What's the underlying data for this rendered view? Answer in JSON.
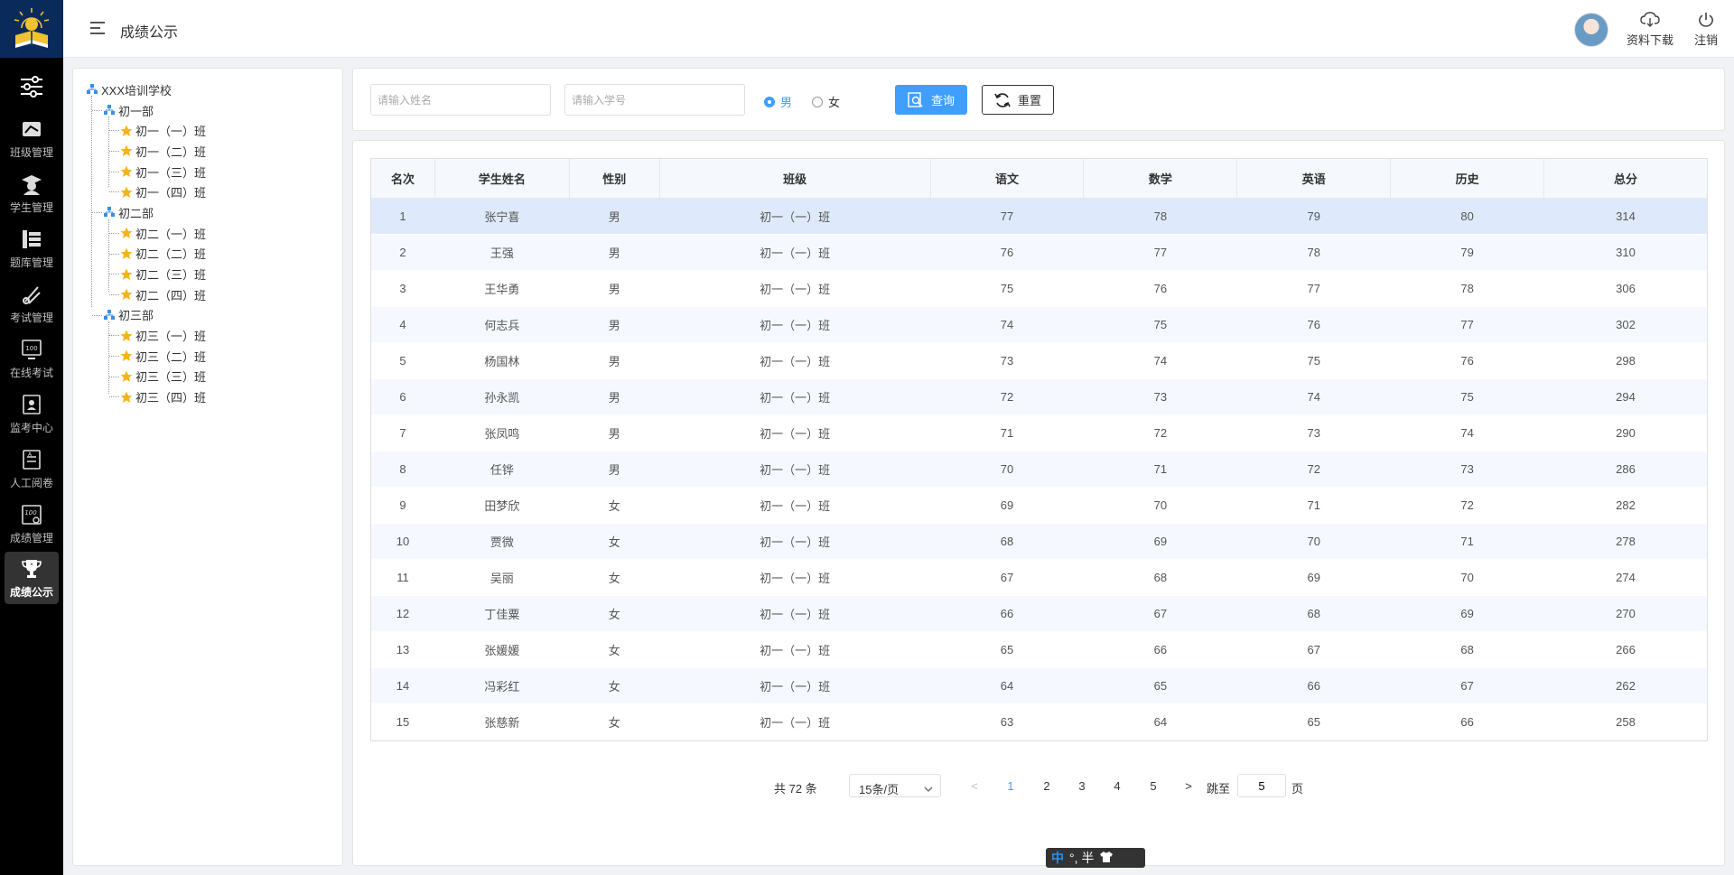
{
  "header": {
    "page_title": "成绩公示",
    "download_label": "资料下载",
    "logout_label": "注销"
  },
  "sidebar": {
    "items": [
      {
        "label": "班级管理",
        "icon": "class-icon"
      },
      {
        "label": "学生管理",
        "icon": "student-icon"
      },
      {
        "label": "题库管理",
        "icon": "question-bank-icon"
      },
      {
        "label": "考试管理",
        "icon": "exam-icon"
      },
      {
        "label": "在线考试",
        "icon": "online-exam-icon"
      },
      {
        "label": "监考中心",
        "icon": "proctor-icon"
      },
      {
        "label": "人工阅卷",
        "icon": "grading-icon"
      },
      {
        "label": "成绩管理",
        "icon": "score-icon"
      },
      {
        "label": "成绩公示",
        "icon": "trophy-icon",
        "active": true
      }
    ]
  },
  "tree": {
    "root": "XXX培训学校",
    "groups": [
      {
        "label": "初一部",
        "classes": [
          "初一（一）班",
          "初一（二）班",
          "初一（三）班",
          "初一（四）班"
        ]
      },
      {
        "label": "初二部",
        "classes": [
          "初二（一）班",
          "初二（二）班",
          "初二（三）班",
          "初二（四）班"
        ]
      },
      {
        "label": "初三部",
        "classes": [
          "初三（一）班",
          "初三（二）班",
          "初三（三）班",
          "初三（四）班"
        ]
      }
    ]
  },
  "search": {
    "name_placeholder": "请输入姓名",
    "id_placeholder": "请输入学号",
    "male_label": "男",
    "female_label": "女",
    "selected_gender": "男",
    "query_label": "查询",
    "reset_label": "重置"
  },
  "table": {
    "columns": [
      "名次",
      "学生姓名",
      "性别",
      "班级",
      "语文",
      "数学",
      "英语",
      "历史",
      "总分"
    ],
    "rows": [
      [
        "1",
        "张宁喜",
        "男",
        "初一（一）班",
        "77",
        "78",
        "79",
        "80",
        "314"
      ],
      [
        "2",
        "王强",
        "男",
        "初一（一）班",
        "76",
        "77",
        "78",
        "79",
        "310"
      ],
      [
        "3",
        "王华勇",
        "男",
        "初一（一）班",
        "75",
        "76",
        "77",
        "78",
        "306"
      ],
      [
        "4",
        "何志兵",
        "男",
        "初一（一）班",
        "74",
        "75",
        "76",
        "77",
        "302"
      ],
      [
        "5",
        "杨国林",
        "男",
        "初一（一）班",
        "73",
        "74",
        "75",
        "76",
        "298"
      ],
      [
        "6",
        "孙永凯",
        "男",
        "初一（一）班",
        "72",
        "73",
        "74",
        "75",
        "294"
      ],
      [
        "7",
        "张凤鸣",
        "男",
        "初一（一）班",
        "71",
        "72",
        "73",
        "74",
        "290"
      ],
      [
        "8",
        "任铧",
        "男",
        "初一（一）班",
        "70",
        "71",
        "72",
        "73",
        "286"
      ],
      [
        "9",
        "田梦欣",
        "女",
        "初一（一）班",
        "69",
        "70",
        "71",
        "72",
        "282"
      ],
      [
        "10",
        "贾微",
        "女",
        "初一（一）班",
        "68",
        "69",
        "70",
        "71",
        "278"
      ],
      [
        "11",
        "吴丽",
        "女",
        "初一（一）班",
        "67",
        "68",
        "69",
        "70",
        "274"
      ],
      [
        "12",
        "丁佳粟",
        "女",
        "初一（一）班",
        "66",
        "67",
        "68",
        "69",
        "270"
      ],
      [
        "13",
        "张媛媛",
        "女",
        "初一（一）班",
        "65",
        "66",
        "67",
        "68",
        "266"
      ],
      [
        "14",
        "冯彩红",
        "女",
        "初一（一）班",
        "64",
        "65",
        "66",
        "67",
        "262"
      ],
      [
        "15",
        "张慈新",
        "女",
        "初一（一）班",
        "63",
        "64",
        "65",
        "66",
        "258"
      ]
    ],
    "highlighted_row": 0
  },
  "pagination": {
    "total_text": "共 72 条",
    "page_size": "15条/页",
    "prev": "<",
    "next": ">",
    "pages": [
      "1",
      "2",
      "3",
      "4",
      "5"
    ],
    "current_page": "1",
    "jump_label": "跳至",
    "jump_value": "5",
    "page_unit": "页"
  },
  "ime": {
    "mode": "中",
    "extra": "°, 半"
  },
  "colors": {
    "accent": "#409eff",
    "sidebar_bg": "#000000",
    "row_highlight": "#deeafb"
  }
}
